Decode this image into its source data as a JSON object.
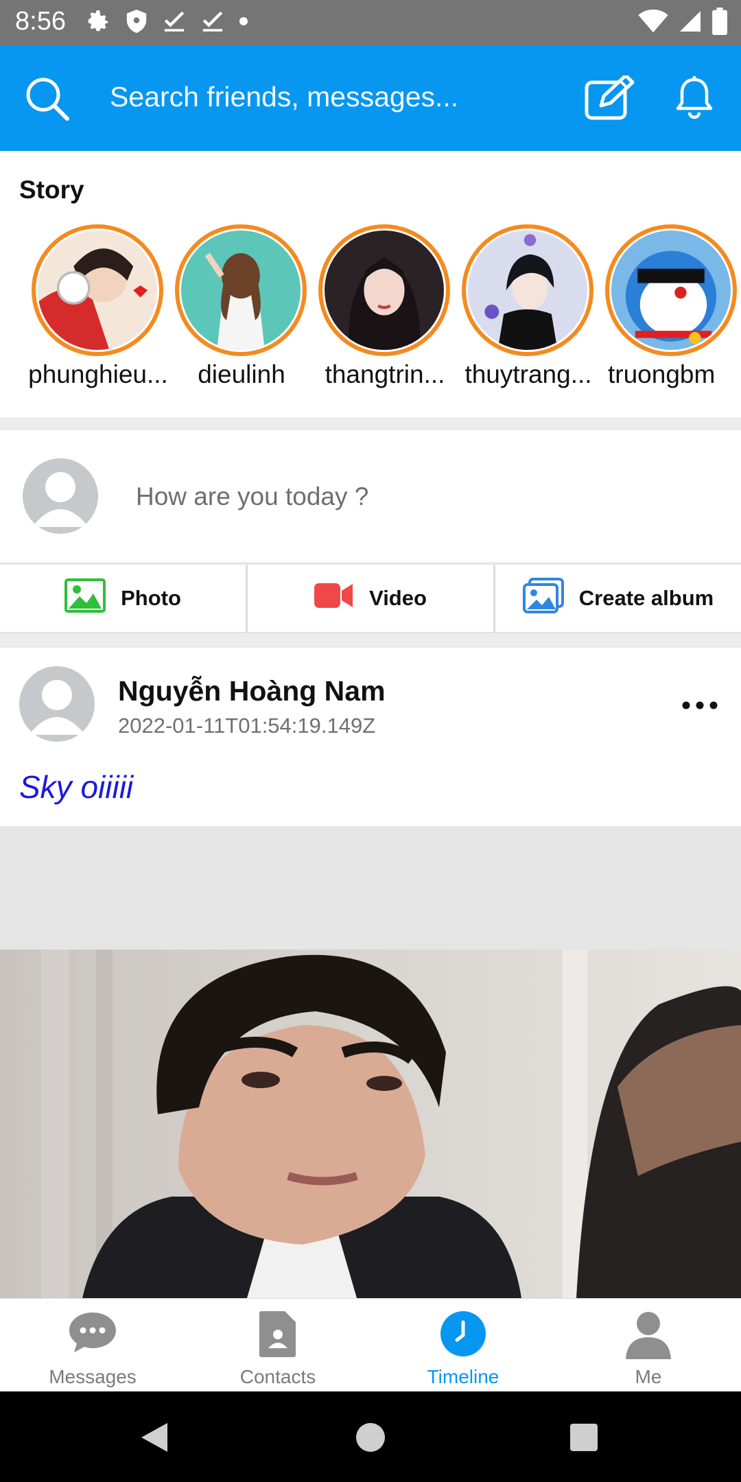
{
  "status_bar": {
    "time": "8:56"
  },
  "header": {
    "search_placeholder": "Search friends, messages..."
  },
  "story": {
    "title": "Story",
    "items": [
      {
        "name": "phunghieu..."
      },
      {
        "name": "dieulinh"
      },
      {
        "name": "thangtrin..."
      },
      {
        "name": "thuytrang..."
      },
      {
        "name": "truongbm"
      }
    ]
  },
  "composer": {
    "prompt": "How are you today ?",
    "actions": [
      {
        "label": "Photo",
        "icon": "image-icon",
        "color": "#2fbf3a"
      },
      {
        "label": "Video",
        "icon": "video-camera-icon",
        "color": "#f04848"
      },
      {
        "label": "Create album",
        "icon": "album-icon",
        "color": "#2f86e0"
      }
    ]
  },
  "post": {
    "author": "Nguyễn Hoàng Nam",
    "timestamp": "2022-01-11T01:54:19.149Z",
    "content": "Sky oiiiii"
  },
  "bottom_nav": {
    "items": [
      {
        "label": "Messages",
        "icon": "chat-bubble-icon",
        "active": false
      },
      {
        "label": "Contacts",
        "icon": "contact-card-icon",
        "active": false
      },
      {
        "label": "Timeline",
        "icon": "clock-icon",
        "active": true
      },
      {
        "label": "Me",
        "icon": "person-icon",
        "active": false
      }
    ]
  },
  "colors": {
    "header_blue": "#0797f1",
    "story_ring": "#f58a1f",
    "post_text": "#1a1adc"
  }
}
